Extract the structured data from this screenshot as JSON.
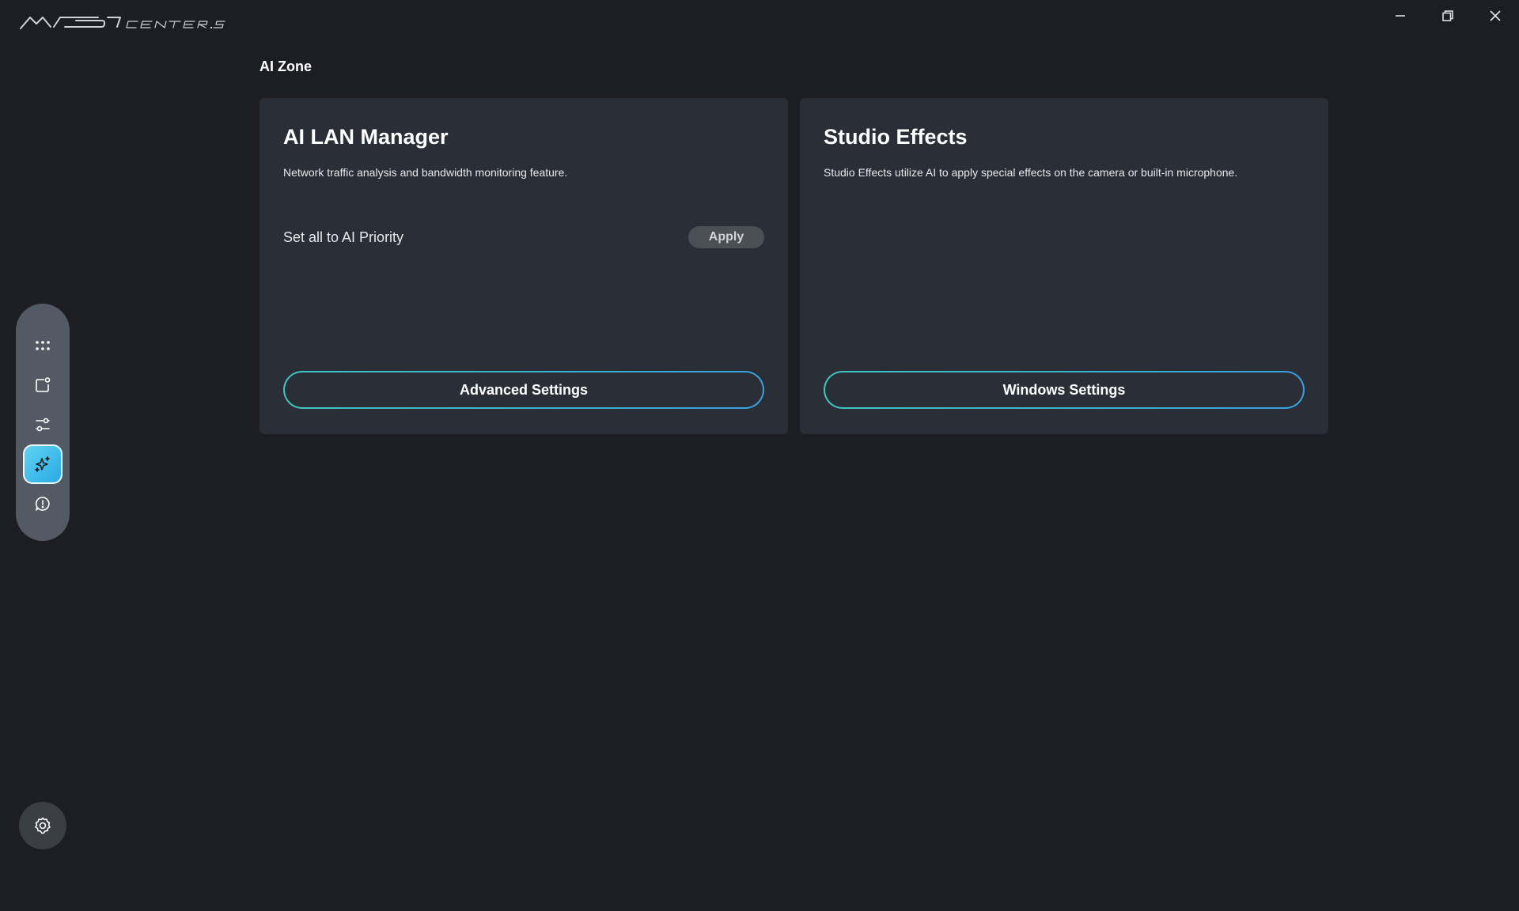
{
  "app": {
    "logo_text": "MSI CENTER S"
  },
  "window": {
    "controls": [
      {
        "name": "minimize",
        "icon": "minimize-icon"
      },
      {
        "name": "restore",
        "icon": "restore-icon"
      },
      {
        "name": "close",
        "icon": "close-icon"
      }
    ]
  },
  "sidebar": {
    "items": [
      {
        "id": "apps",
        "icon": "grid-dots-icon",
        "active": false
      },
      {
        "id": "device",
        "icon": "device-icon",
        "active": false
      },
      {
        "id": "tuning",
        "icon": "sliders-icon",
        "active": false
      },
      {
        "id": "ai-zone",
        "icon": "sparkle-icon",
        "active": true
      },
      {
        "id": "support",
        "icon": "alert-chat-icon",
        "active": false
      }
    ],
    "settings_icon": "gear-icon"
  },
  "main": {
    "title": "AI Zone",
    "cards": [
      {
        "title": "AI LAN Manager",
        "description": "Network traffic analysis and bandwidth monitoring feature.",
        "row_label": "Set all to AI Priority",
        "row_button": "Apply",
        "action_button": "Advanced Settings"
      },
      {
        "title": "Studio Effects",
        "description": "Studio Effects utilize AI to apply special effects on the camera or built-in microphone.",
        "action_button": "Windows Settings"
      }
    ]
  },
  "colors": {
    "background": "#1c1e23",
    "card": "#2a2e36",
    "sidebar": "#545a63",
    "accent_start": "#3ec6c0",
    "accent_end": "#3aa0dd",
    "active_nav": "#2aa9e6"
  }
}
